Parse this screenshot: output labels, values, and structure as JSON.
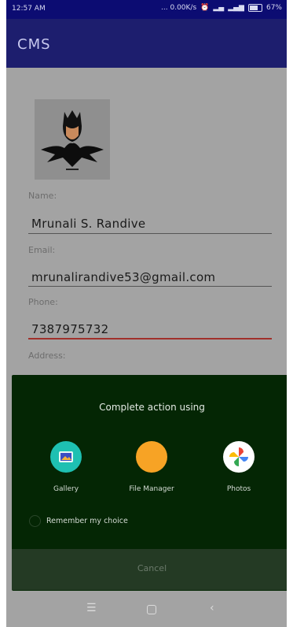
{
  "status_bar": {
    "time": "12:57 AM",
    "net_speed": "... 0.00K/s",
    "battery": "67%",
    "icons": [
      "alarm-icon",
      "signal-icon",
      "signal-icon",
      "battery-icon"
    ]
  },
  "app_bar": {
    "title": "CMS"
  },
  "form": {
    "avatar_icon": "batman-avatar",
    "name_label": "Name:",
    "name_value": "Mrunali S. Randive",
    "email_label": "Email:",
    "email_value": "mrunalirandive53@gmail.com",
    "phone_label": "Phone:",
    "phone_value": "7387975732",
    "address_label": "Address:"
  },
  "chooser": {
    "title": "Complete action using",
    "apps": [
      {
        "label": "Gallery",
        "icon": "gallery-icon"
      },
      {
        "label": "File Manager",
        "icon": "file-manager-icon"
      },
      {
        "label": "Photos",
        "icon": "photos-icon"
      }
    ],
    "remember_label": "Remember my choice",
    "cancel_label": "Cancel"
  },
  "nav_bar": {
    "icons": [
      "menu-icon",
      "home-icon",
      "back-icon"
    ]
  }
}
